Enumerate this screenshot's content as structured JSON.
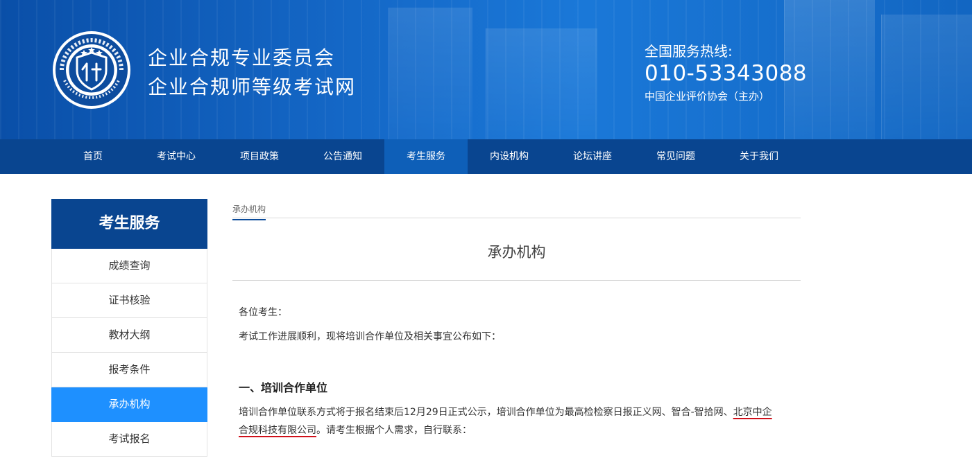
{
  "header": {
    "logo_icon": "committee-seal-icon",
    "title_line1": "企业合规专业委员会",
    "title_line2": "企业合规师等级考试网",
    "hotline_label": "全国服务热线:",
    "hotline_number": "010-53343088",
    "organizer": "中国企业评价协会（主办）"
  },
  "nav": {
    "items": [
      "首页",
      "考试中心",
      "项目政策",
      "公告通知",
      "考生服务",
      "内设机构",
      "论坛讲座",
      "常见问题",
      "关于我们"
    ],
    "active": "考生服务"
  },
  "sidebar": {
    "title": "考生服务",
    "items": [
      "成绩查询",
      "证书核验",
      "教材大纲",
      "报考条件",
      "承办机构",
      "考试报名"
    ],
    "active": "承办机构"
  },
  "breadcrumb": {
    "current": "承办机构"
  },
  "article": {
    "title": "承办机构",
    "greeting": "各位考生：",
    "intro": "考试工作进展顺利，现将培训合作单位及相关事宜公布如下：",
    "section1_heading": "一、培训合作单位",
    "body_part1": "培训合作单位联系方式将于报名结束后12月29日正式公示，培训合作单位为最高检检察日报正义网、智合-智拾网、",
    "body_underlined_1": "北京中企",
    "body_underlined_2": "合规科技有限公司",
    "body_part2": "。请考生根据个人需求，自行联系："
  },
  "colors": {
    "nav_bg": "#094590",
    "nav_active": "#0e5fb8",
    "sidebar_active": "#1e90ff",
    "annotation_red": "#d0101a"
  }
}
